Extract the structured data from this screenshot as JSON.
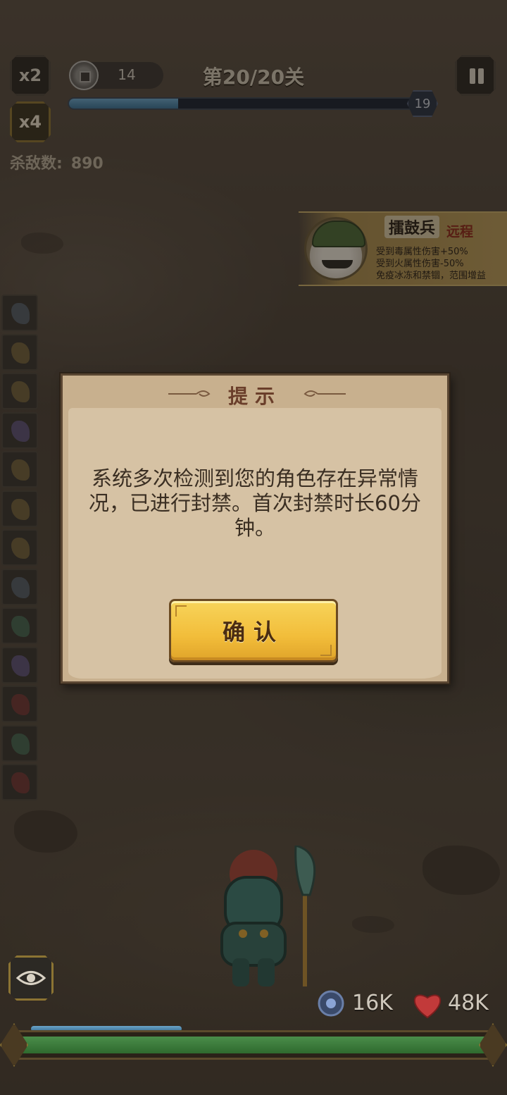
{
  "hud": {
    "speed_x2": "x2",
    "speed_x4": "x4",
    "coins": "14",
    "level": "第20/20关",
    "wave_progress": 0.3,
    "wave_badge": "19",
    "kills_label": "杀敌数:",
    "kills_value": "890"
  },
  "enemy_card": {
    "name": "擂鼓兵",
    "type": "远程",
    "lines": [
      "受到毒属性伤害+50%",
      "受到火属性伤害-50%",
      "免疫冰冻和禁锢，范围增益"
    ]
  },
  "equipment_slot_count": 13,
  "dialog": {
    "title": "提示",
    "message": "系统多次检测到您的角色存在异常情况，已进行封禁。首次封禁时长60分钟。",
    "confirm_label": "确认"
  },
  "stats": {
    "attack": "16K",
    "health": "48K",
    "mana_progress": 0.3,
    "hp_progress": 1.0
  },
  "colors": {
    "dialog_bg": "#c8b08e",
    "dialog_inner": "#d6c2a4",
    "confirm_button": "#f2bd3a",
    "hp_bar": "#2f6a2e",
    "progress_blue": "#3a7196"
  },
  "icons": [
    "coin-icon",
    "pause-icon",
    "eye-icon",
    "attack-icon",
    "heart-icon"
  ]
}
